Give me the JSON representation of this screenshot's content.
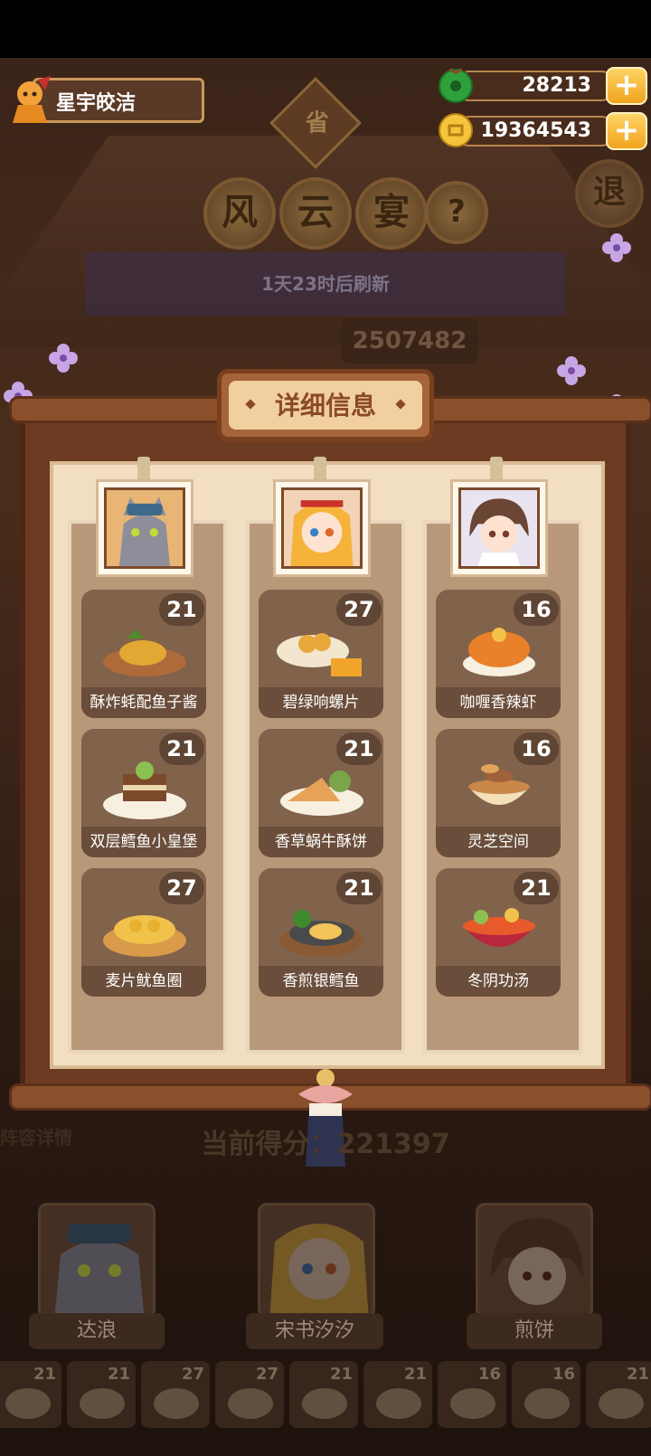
{
  "player": {
    "name": "星宇皎洁"
  },
  "currency": {
    "jade": "28213",
    "coins": "19364543",
    "plus": "+"
  },
  "title": {
    "province": "省",
    "chars": [
      "风",
      "云",
      "宴"
    ],
    "help": "?",
    "exit": "退"
  },
  "refresh_text": "1天23时后刷新",
  "top_score": "2507482",
  "panel": {
    "title": "详细信息",
    "columns": [
      {
        "dishes": [
          {
            "name": "酥炸蚝配鱼子酱",
            "count": "21"
          },
          {
            "name": "双层鳕鱼小皇堡",
            "count": "21"
          },
          {
            "name": "麦片鱿鱼圈",
            "count": "27"
          }
        ]
      },
      {
        "dishes": [
          {
            "name": "碧绿响螺片",
            "count": "27"
          },
          {
            "name": "香草蜗牛酥饼",
            "count": "21"
          },
          {
            "name": "香煎银鳕鱼",
            "count": "21"
          }
        ]
      },
      {
        "dishes": [
          {
            "name": "咖喱香辣虾",
            "count": "16"
          },
          {
            "name": "灵芝空间",
            "count": "16"
          },
          {
            "name": "冬阴功汤",
            "count": "21"
          }
        ]
      }
    ]
  },
  "bottom": {
    "lineup_label": "阵容详情",
    "score": "当前得分：221397",
    "characters": [
      "达浪",
      "宋书汐汐",
      "煎饼"
    ],
    "mini_counts": [
      "21",
      "21",
      "27",
      "27",
      "21",
      "21",
      "16",
      "16",
      "21"
    ]
  }
}
